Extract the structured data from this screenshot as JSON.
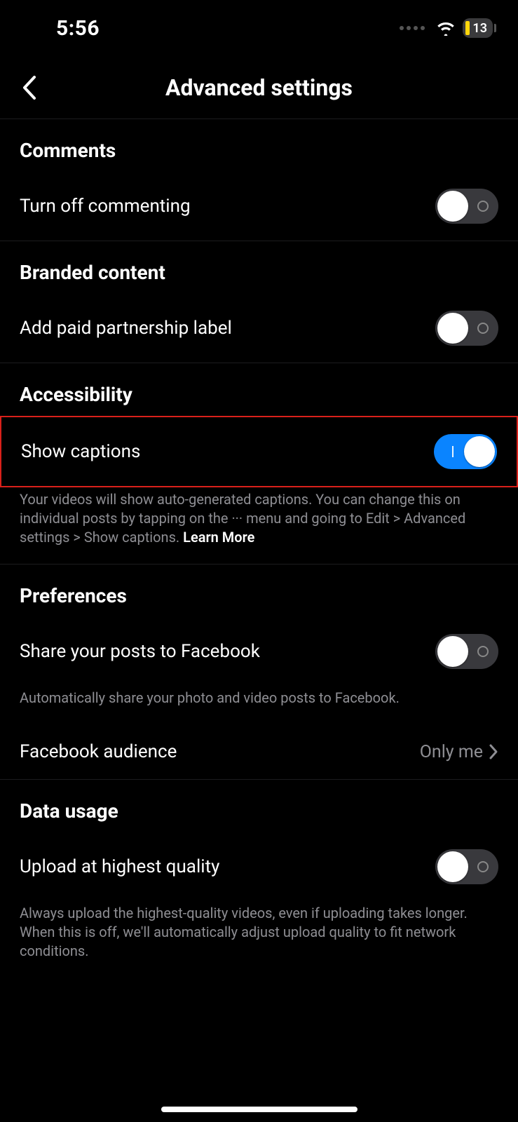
{
  "status": {
    "time": "5:56",
    "battery_pct": "13"
  },
  "nav": {
    "title": "Advanced settings"
  },
  "sections": {
    "comments": {
      "header": "Comments",
      "toggle_off_commenting": {
        "label": "Turn off commenting",
        "on": false
      }
    },
    "branded": {
      "header": "Branded content",
      "paid_label": {
        "label": "Add paid partnership label",
        "on": false
      }
    },
    "accessibility": {
      "header": "Accessibility",
      "show_captions": {
        "label": "Show captions",
        "on": true
      },
      "footer_pre": "Your videos will show auto-generated captions. You can change this on individual posts by tapping on the  ···  menu and going to Edit > Advanced settings > Show captions. ",
      "footer_link": "Learn More"
    },
    "preferences": {
      "header": "Preferences",
      "share_fb": {
        "label": "Share your posts to Facebook",
        "on": false
      },
      "share_fb_footer": "Automatically share your photo and video posts to Facebook.",
      "fb_audience": {
        "label": "Facebook audience",
        "value": "Only me"
      }
    },
    "data_usage": {
      "header": "Data usage",
      "upload_hq": {
        "label": "Upload at highest quality",
        "on": false
      },
      "upload_hq_footer": "Always upload the highest-quality videos, even if uploading takes longer. When this is off, we'll automatically adjust upload quality to fit network conditions."
    }
  }
}
